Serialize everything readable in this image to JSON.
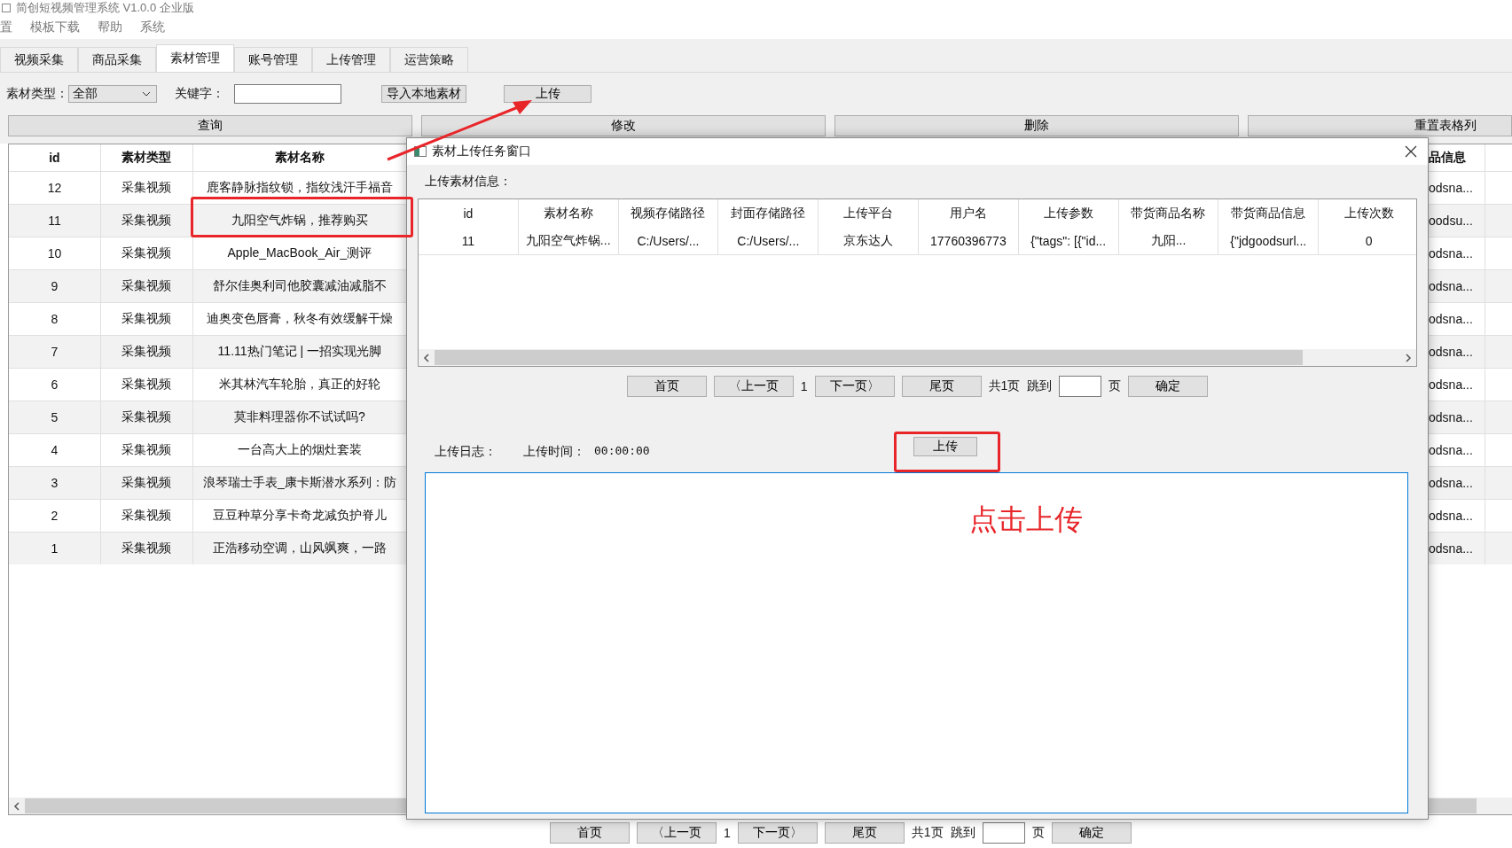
{
  "window": {
    "title": "简创短视频管理系统 V1.0.0 企业版"
  },
  "menu": [
    "置",
    "模板下载",
    "帮助",
    "系统"
  ],
  "tabs": [
    {
      "label": "视频采集",
      "selected": false
    },
    {
      "label": "商品采集",
      "selected": false
    },
    {
      "label": "素材管理",
      "selected": true
    },
    {
      "label": "账号管理",
      "selected": false
    },
    {
      "label": "上传管理",
      "selected": false
    },
    {
      "label": "运营策略",
      "selected": false
    }
  ],
  "filters": {
    "type_label": "素材类型：",
    "type_value": "全部",
    "keyword_label": "关键字："
  },
  "toolbar_buttons": [
    "导入本地素材",
    "上传"
  ],
  "action_buttons": [
    "查询",
    "修改",
    "删除",
    "重置表格列"
  ],
  "table": {
    "columns": [
      "id",
      "素材类型",
      "素材名称",
      "品信息"
    ],
    "rows": [
      {
        "id": "12",
        "type": "采集视频",
        "name": "鹿客静脉指纹锁，指纹浅汗手福音",
        "goods": "odsna..."
      },
      {
        "id": "11",
        "type": "采集视频",
        "name": "九阳空气炸锅，推荐购买",
        "goods": "oodsu..."
      },
      {
        "id": "10",
        "type": "采集视频",
        "name": "Apple_MacBook_Air_测评",
        "goods": "odsna..."
      },
      {
        "id": "9",
        "type": "采集视频",
        "name": "舒尔佳奥利司他胶囊减油减脂不",
        "goods": "odsna..."
      },
      {
        "id": "8",
        "type": "采集视频",
        "name": "迪奥变色唇膏，秋冬有效缓解干燥",
        "goods": "odsna..."
      },
      {
        "id": "7",
        "type": "采集视频",
        "name": "11.11热门笔记 | 一招实现光脚",
        "goods": "odsna..."
      },
      {
        "id": "6",
        "type": "采集视频",
        "name": "米其林汽车轮胎，真正的好轮",
        "goods": "odsna..."
      },
      {
        "id": "5",
        "type": "采集视频",
        "name": "莫非料理器你不试试吗?",
        "goods": "odsna..."
      },
      {
        "id": "4",
        "type": "采集视频",
        "name": "一台高大上的烟灶套装",
        "goods": "odsna..."
      },
      {
        "id": "3",
        "type": "采集视频",
        "name": "浪琴瑞士手表_康卡斯潜水系列：防",
        "goods": "odsna..."
      },
      {
        "id": "2",
        "type": "采集视频",
        "name": "豆豆种草分享卡奇龙减负护脊儿",
        "goods": "odsna..."
      },
      {
        "id": "1",
        "type": "采集视频",
        "name": "正浩移动空调，山风飒爽，一路",
        "goods": "odsna..."
      }
    ]
  },
  "pagination": {
    "first": "首页",
    "prev": "〈上一页",
    "page": "1",
    "next": "下一页〉",
    "last": "尾页",
    "total": "共1页",
    "jump": "跳到",
    "unit": "页",
    "confirm": "确定"
  },
  "dialog": {
    "title": "素材上传任务窗口",
    "info_label": "上传素材信息：",
    "table": {
      "columns": [
        "id",
        "素材名称",
        "视频存储路径",
        "封面存储路径",
        "上传平台",
        "用户名",
        "上传参数",
        "带货商品名称",
        "带货商品信息",
        "上传次数"
      ],
      "rows": [
        [
          "11",
          "九阳空气炸锅...",
          "C:/Users/...",
          "C:/Users/...",
          "京东达人",
          "17760396773",
          "{\"tags\": [{\"id...",
          "九阳...",
          "{\"jdgoodsurl...",
          "0"
        ]
      ]
    },
    "pagination": {
      "first": "首页",
      "prev": "〈上一页",
      "page": "1",
      "next": "下一页〉",
      "last": "尾页",
      "total": "共1页",
      "jump": "跳到",
      "unit": "页",
      "confirm": "确定"
    },
    "log_label": "上传日志：",
    "time_label": "上传时间：",
    "time_value": "00:00:00",
    "upload_button": "上传"
  },
  "annotation": {
    "note": "点击上传"
  }
}
